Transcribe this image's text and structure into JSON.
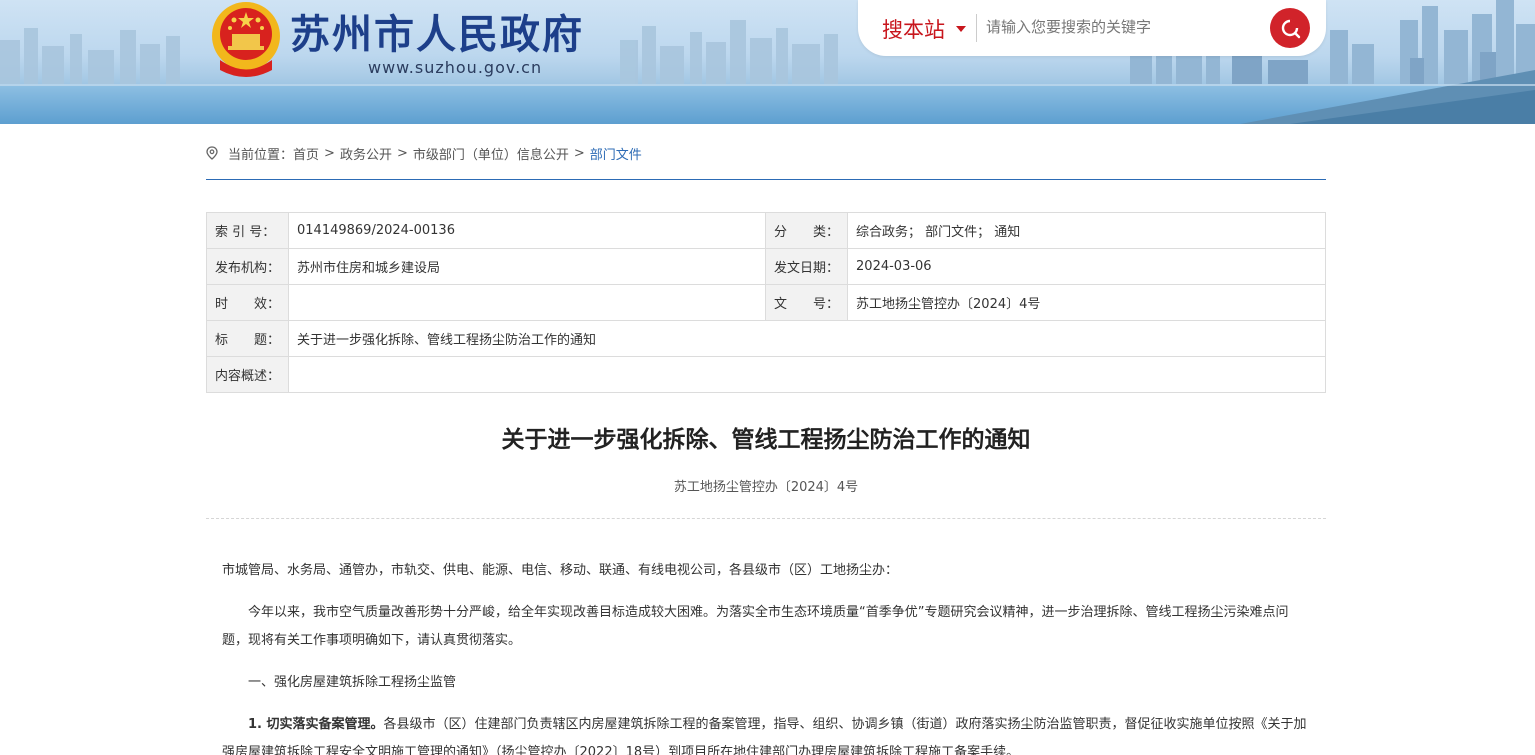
{
  "header": {
    "site_name": "苏州市人民政府",
    "site_url": "www.suzhou.gov.cn",
    "emblem_icon": "national-emblem-icon",
    "search": {
      "scope": "搜本站",
      "placeholder": "请输入您要搜索的关键字",
      "button_icon": "search-icon"
    }
  },
  "breadcrumb": {
    "prefix": "当前位置：",
    "items": [
      "首页",
      "政务公开",
      "市级部门（单位）信息公开",
      "部门文件"
    ],
    "separator": ">"
  },
  "meta": {
    "index_label": "索 引 号：",
    "index_value": "014149869/2024-00136",
    "category_label": "分　　类：",
    "category_value": "综合政务； 部门文件； 通知",
    "issuer_label": "发布机构：",
    "issuer_value": "苏州市住房和城乡建设局",
    "date_label": "发文日期：",
    "date_value": "2024-03-06",
    "validity_label": "时　　效：",
    "validity_value": "",
    "docno_label": "文　　号：",
    "docno_value": "苏工地扬尘管控办〔2024〕4号",
    "title_label": "标　　题：",
    "title_value": "关于进一步强化拆除、管线工程扬尘防治工作的通知",
    "summary_label": "内容概述：",
    "summary_value": ""
  },
  "article": {
    "title": "关于进一步强化拆除、管线工程扬尘防治工作的通知",
    "doc_number": "苏工地扬尘管控办〔2024〕4号",
    "recipients": "市城管局、水务局、通管办，市轨交、供电、能源、电信、移动、联通、有线电视公司，各县级市（区）工地扬尘办：",
    "para1": "今年以来，我市空气质量改善形势十分严峻，给全年实现改善目标造成较大困难。为落实全市生态环境质量“首季争优”专题研究会议精神，进一步治理拆除、管线工程扬尘污染难点问题，现将有关工作事项明确如下，请认真贯彻落实。",
    "section1": "一、强化房屋建筑拆除工程扬尘监管",
    "item1_title": "1. 切实落实备案管理。",
    "item1_text": "各县级市（区）住建部门负责辖区内房屋建筑拆除工程的备案管理，指导、组织、协调乡镇（街道）政府落实扬尘防治监管职责，督促征收实施单位按照《关于加强房屋建筑拆除工程安全文明施工管理的通知》（扬尘管控办〔2022〕18号）到项目所在地住建部门办理房屋建筑拆除工程施工备案手续。"
  }
}
